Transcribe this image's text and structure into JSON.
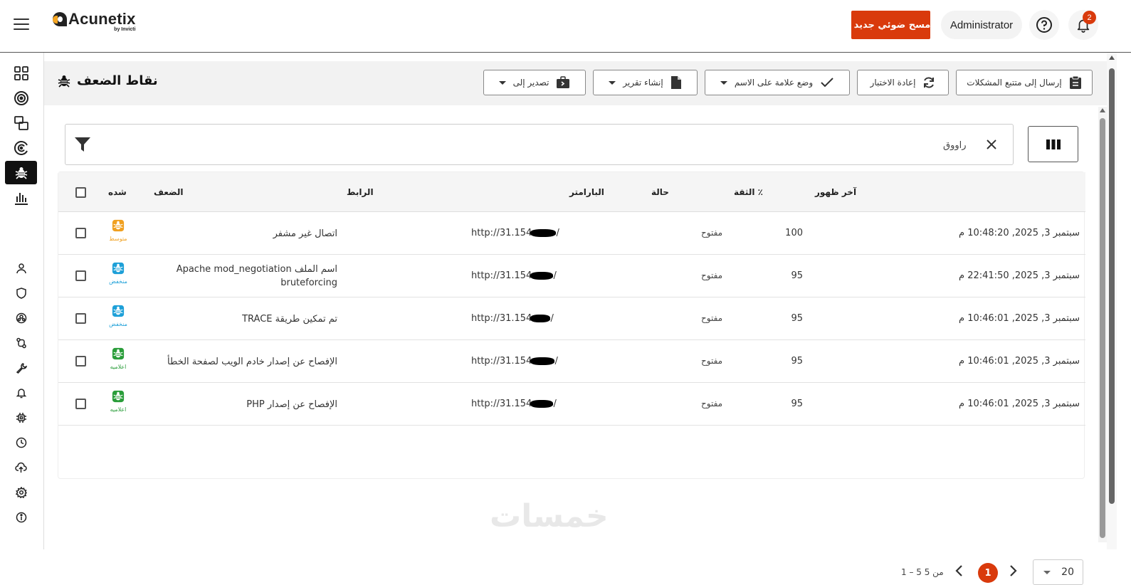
{
  "header": {
    "brand": "Acunetix",
    "brand_sub": "by Invicti",
    "new_scan_label": "مسح ضوئي جديد",
    "user_label": "Administrator",
    "notification_count": "2"
  },
  "page": {
    "title": "نقاط الضعف"
  },
  "toolbar": {
    "send_tracker": "إرسال إلى متتبع المشكلات",
    "retest": "إعادة الاختبار",
    "mark_as": "وضع علامة على الاسم",
    "generate_report": "إنشاء تقرير",
    "export": "تصدير إلى"
  },
  "filter": {
    "chip": "راووق"
  },
  "table": {
    "headers": {
      "severity": "شده",
      "vulnerability": "الضعف",
      "url": "الرابط",
      "parameter": "البارامتر",
      "status": "حالة",
      "confidence": "الثقة ٪",
      "last_seen": "آخر ظهور"
    },
    "rows": [
      {
        "severity": "متوسط",
        "severity_color": "#f0a020",
        "vulnerability": "اتصال غير مشفر",
        "url": "http://31.154.",
        "status": "مفتوح",
        "confidence": "100",
        "last_seen": "سبتمبر 3, 2025, 10:48:20 م"
      },
      {
        "severity": "منخفض",
        "severity_color": "#1ea0d8",
        "vulnerability": "اسم الملف Apache mod_negotiation bruteforcing",
        "url": "http://31.154.",
        "status": "مفتوح",
        "confidence": "95",
        "last_seen": "سبتمبر 3, 2025, 22:41:50 م"
      },
      {
        "severity": "منخفض",
        "severity_color": "#1ea0d8",
        "vulnerability": "تم تمكين طريقة TRACE",
        "url": "http://31.154.",
        "status": "مفتوح",
        "confidence": "95",
        "last_seen": "سبتمبر 3, 2025, 10:46:01 م"
      },
      {
        "severity": "اعلاميه",
        "severity_color": "#2a9d3a",
        "vulnerability": "الإفصاح عن إصدار خادم الويب لصفحة الخطأ",
        "url": "http://31.154.",
        "status": "مفتوح",
        "confidence": "95",
        "last_seen": "سبتمبر 3, 2025, 10:46:01 م"
      },
      {
        "severity": "اعلاميه",
        "severity_color": "#2a9d3a",
        "vulnerability": "الإفصاح عن إصدار PHP",
        "url": "http://31.154.",
        "status": "مفتوح",
        "confidence": "95",
        "last_seen": "سبتمبر 3, 2025, 10:46:01 م"
      }
    ]
  },
  "pagination": {
    "count": "1 – 5 من 5",
    "current_page": "1",
    "page_size": "20"
  },
  "watermark": "خمسات",
  "colors": {
    "accent": "#d93a0c"
  }
}
